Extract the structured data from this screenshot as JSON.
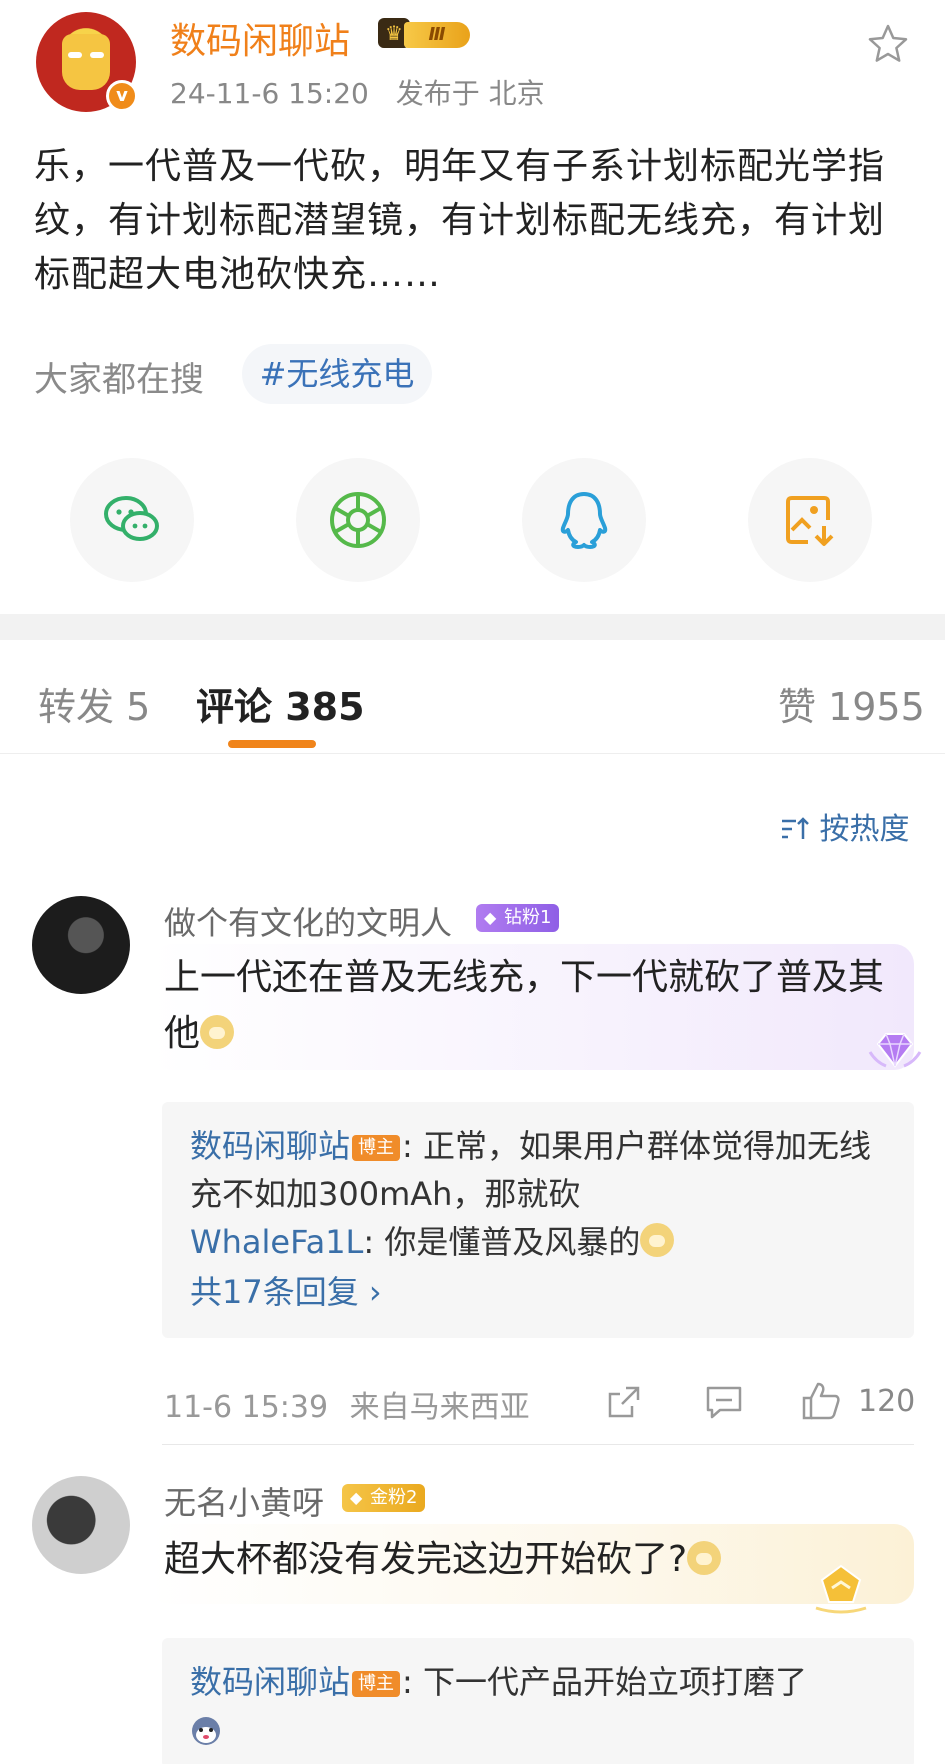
{
  "post": {
    "author": "数码闲聊站",
    "vip_level": "Ⅲ",
    "verified_mark": "v",
    "date": "24-11-6 15:20",
    "location": "发布于 北京",
    "content": "乐，一代普及一代砍，明年又有子系计划标配光学指纹，有计划标配潜望镜，有计划标配无线充，有计划标配超大电池砍快充……",
    "search_label": "大家都在搜",
    "hashtag": "#无线充电"
  },
  "share": [
    {
      "icon": "wechat-icon",
      "color": "#33b06a"
    },
    {
      "icon": "moments-icon",
      "color": "#55b94a"
    },
    {
      "icon": "qq-icon",
      "color": "#2a9fd8"
    },
    {
      "icon": "save-image-icon",
      "color": "#f0a020"
    }
  ],
  "tabs": {
    "repost": "转发 5",
    "comments": "评论 385",
    "likes": "赞 1955"
  },
  "sort": {
    "label": "按热度",
    "icon": "sort-icon"
  },
  "comments": [
    {
      "user": "做个有文化的文明人",
      "badge": "钻粉1",
      "badge_color": "#9b6cf0",
      "text": "上一代还在普及无线充，下一代就砍了普及其他",
      "replies": [
        {
          "name": "数码闲聊站",
          "owner_tag": "博主",
          "text": ": 正常，如果用户群体觉得加无线充不如加300mAh，那就砍"
        },
        {
          "name": "WhaleFa1L",
          "owner_tag": "",
          "text": ": 你是懂普及风暴的"
        }
      ],
      "more_replies": "共17条回复 ›",
      "time": "11-6 15:39",
      "from": "来自马来西亚",
      "like_count": "120"
    },
    {
      "user": "无名小黄呀",
      "badge": "金粉2",
      "badge_color": "#f0b52a",
      "text": "超大杯都没有发完这边开始砍了?",
      "replies": [
        {
          "name": "数码闲聊站",
          "owner_tag": "博主",
          "text": ": 下一代产品开始立项打磨了"
        }
      ]
    }
  ]
}
